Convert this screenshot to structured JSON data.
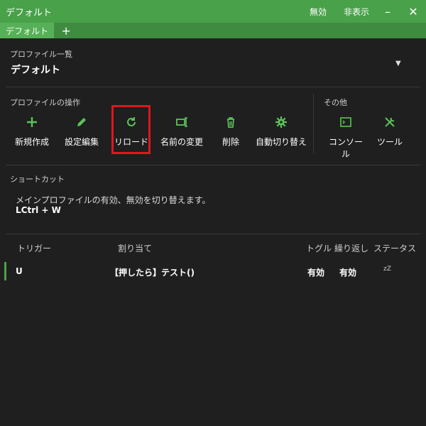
{
  "window": {
    "title": "デフォルト",
    "disable": "無効",
    "hide": "非表示",
    "minimize": "–",
    "close": "✕"
  },
  "tabs": {
    "active": "デフォルト",
    "add": "+"
  },
  "profile": {
    "section_label": "プロファイル一覧",
    "selected": "デフォルト",
    "dropdown_glyph": "▼"
  },
  "operations": {
    "section_label": "プロファイルの操作",
    "items": [
      {
        "label": "新規作成",
        "icon": "plus-icon"
      },
      {
        "label": "設定編集",
        "icon": "pencil-icon"
      },
      {
        "label": "リロード",
        "icon": "reload-icon"
      },
      {
        "label": "名前の変更",
        "icon": "rename-icon"
      },
      {
        "label": "削除",
        "icon": "trash-icon"
      },
      {
        "label": "自動切り替え",
        "icon": "gear-icon"
      }
    ]
  },
  "other": {
    "section_label": "その他",
    "items": [
      {
        "label": "コンソール",
        "icon": "console-icon"
      },
      {
        "label": "ツール",
        "icon": "tools-icon"
      }
    ]
  },
  "shortcut": {
    "section_label": "ショートカット",
    "description": "メインプロファイルの有効、無効を切り替えます。",
    "keys": "LCtrl + W"
  },
  "table": {
    "headers": {
      "trigger": "トリガー",
      "assignment": "割り当て",
      "toggle": "トグル",
      "repeat": "繰り返し",
      "status": "ステータス"
    },
    "rows": [
      {
        "trigger": "U",
        "assignment": "【押したら】テスト()",
        "toggle": "有効",
        "repeat": "有効",
        "status": "zZ"
      }
    ]
  },
  "colors": {
    "accent": "#49a14a",
    "icon_green": "#5cc35a",
    "highlight": "#e0161b",
    "background": "#1f1f1f"
  }
}
